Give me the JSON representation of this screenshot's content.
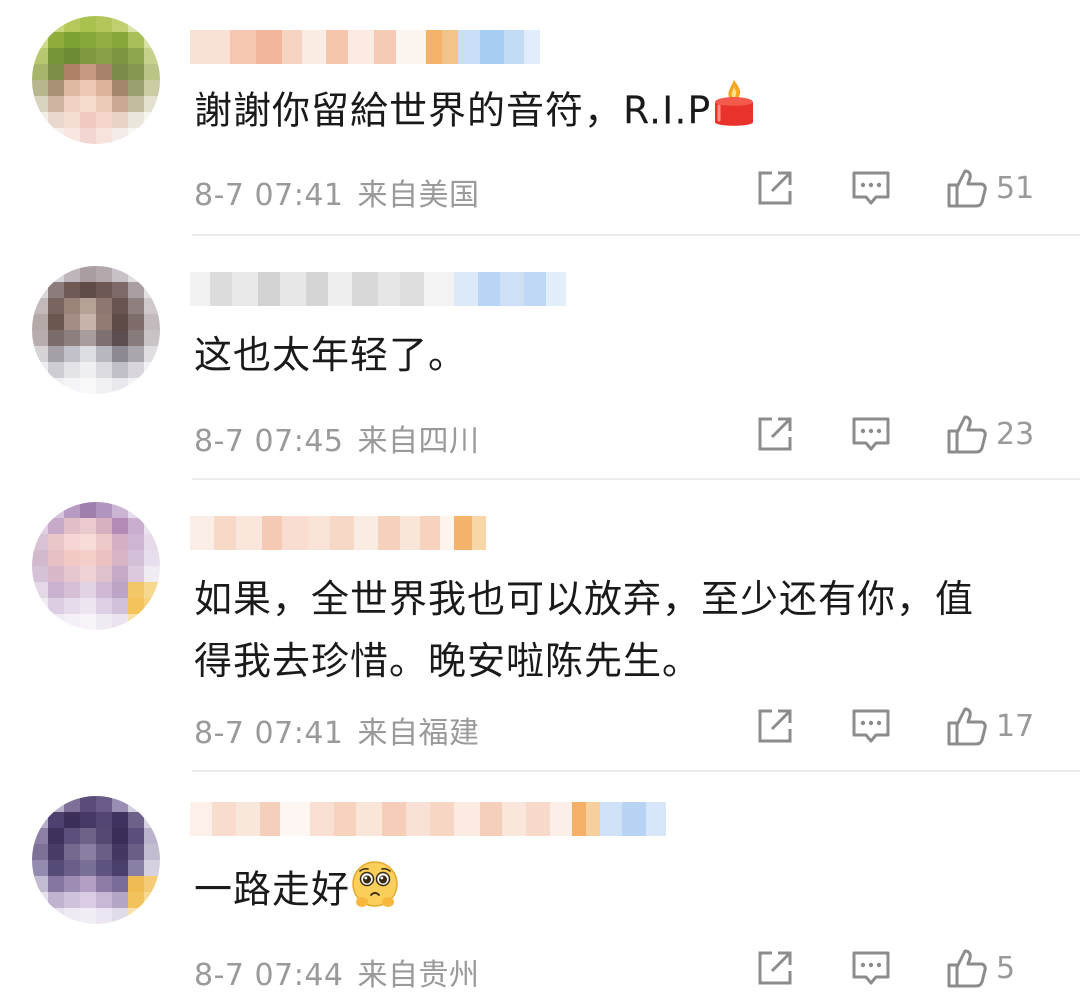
{
  "comments": [
    {
      "text": "謝謝你留給世界的音符，R.I.P",
      "emoji": "candle-icon",
      "time": "8-7 07:41",
      "location": "来自美国",
      "likes": "51"
    },
    {
      "text": "这也太年轻了。",
      "time": "8-7 07:45",
      "location": "来自四川",
      "likes": "23"
    },
    {
      "text_line1": "如果，全世界我也可以放弃，至少还有你，值",
      "text_line2": "得我去珍惜。晚安啦陈先生。",
      "time": "8-7 07:41",
      "location": "来自福建",
      "likes": "17"
    },
    {
      "text": "一路走好",
      "emoji": "pleading-face-icon",
      "time": "8-7 07:44",
      "location": "来自贵州",
      "likes": "5"
    }
  ],
  "colors": {
    "meta": "#9a9a9a",
    "text": "#1a1a1a",
    "divider": "#ececec",
    "icon": "#8c8c8c"
  }
}
